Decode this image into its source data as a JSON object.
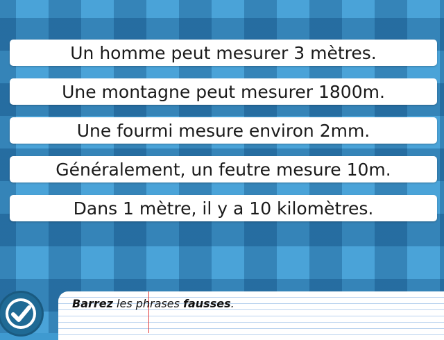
{
  "sentences": [
    {
      "text": "Un homme peut mesurer 3 mètres."
    },
    {
      "text": "Une montagne peut mesurer 1800m."
    },
    {
      "text": "Une fourmi mesure environ 2mm."
    },
    {
      "text": "Généralement, un feutre mesure 10m."
    },
    {
      "text": "Dans 1 mètre, il y a 10 kilomètres."
    }
  ],
  "instruction": {
    "part1": "Barrez",
    "part2": " les phrases ",
    "part3": "fausses",
    "part4": "."
  },
  "validate_icon": "check-circle-icon",
  "colors": {
    "background": "#4aa3d8",
    "button": "#1f6a95",
    "check": "#ffffff",
    "margin_line": "#e33a3a",
    "ruled_line": "#b9d2ee"
  }
}
